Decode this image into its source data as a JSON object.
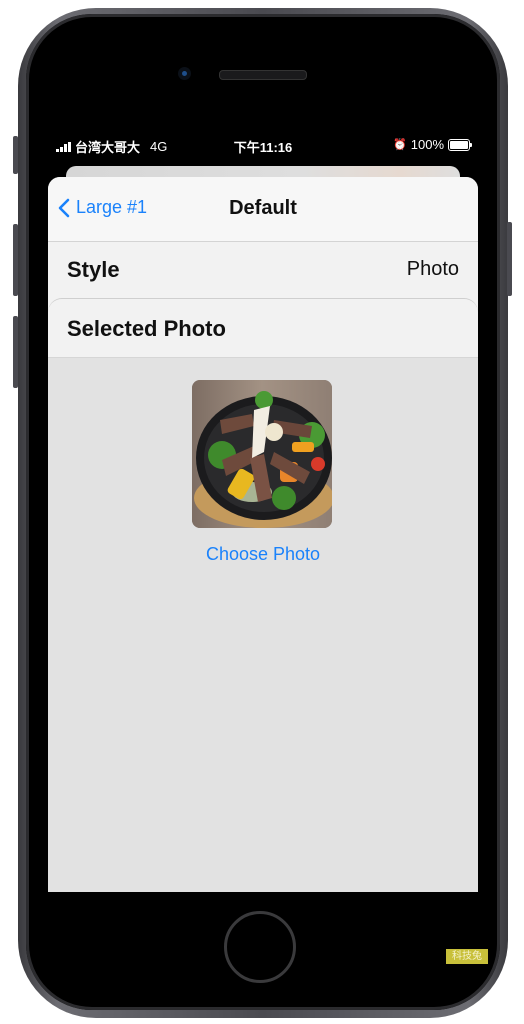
{
  "status_bar": {
    "carrier": "台湾大哥大",
    "network": "4G",
    "time": "下午11:16",
    "battery_percent": "100%",
    "icons": [
      "signal-icon",
      "alarm-icon",
      "battery-icon"
    ]
  },
  "nav": {
    "back_label": "Large #1",
    "title": "Default"
  },
  "style_row": {
    "label": "Style",
    "value": "Photo"
  },
  "selected_photo": {
    "section_title": "Selected Photo",
    "photo_description": "steak with vegetables in cast iron skillet",
    "choose_label": "Choose Photo"
  },
  "colors": {
    "accent": "#1a82fb",
    "sheet_bg": "#f2f2f2",
    "content_bg": "#e2e2e2"
  },
  "watermark": "科技兔"
}
